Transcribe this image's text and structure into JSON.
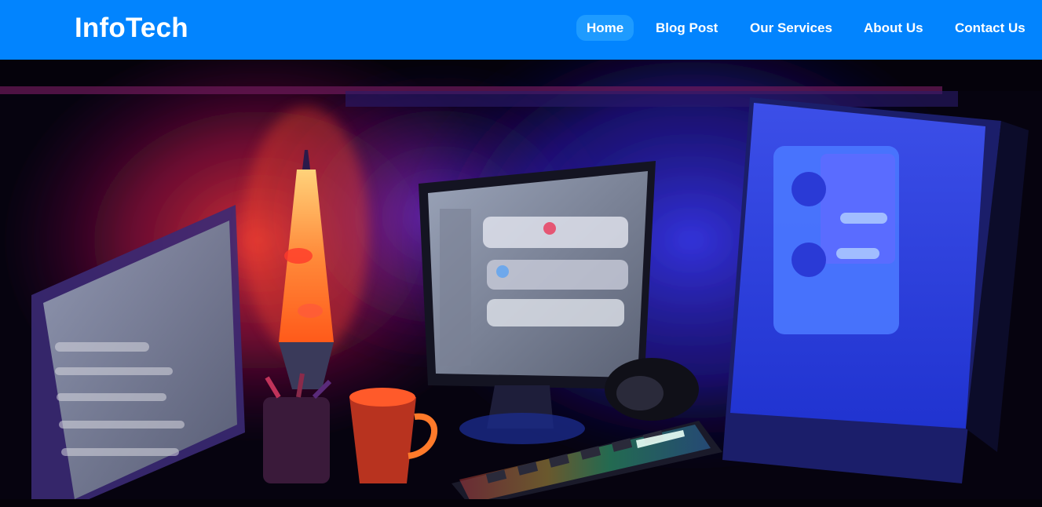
{
  "header": {
    "brand": "InfoTech",
    "nav": [
      {
        "label": "Home",
        "active": true
      },
      {
        "label": "Blog Post",
        "active": false
      },
      {
        "label": "Our Services",
        "active": false
      },
      {
        "label": "About Us",
        "active": false
      },
      {
        "label": "Contact Us",
        "active": false
      }
    ],
    "colors": {
      "bar": "#0284fe",
      "active_pill": "#1e9bff",
      "text": "#ffffff"
    }
  },
  "hero": {
    "image": "gaming-desk-setup-neon-illustration"
  }
}
